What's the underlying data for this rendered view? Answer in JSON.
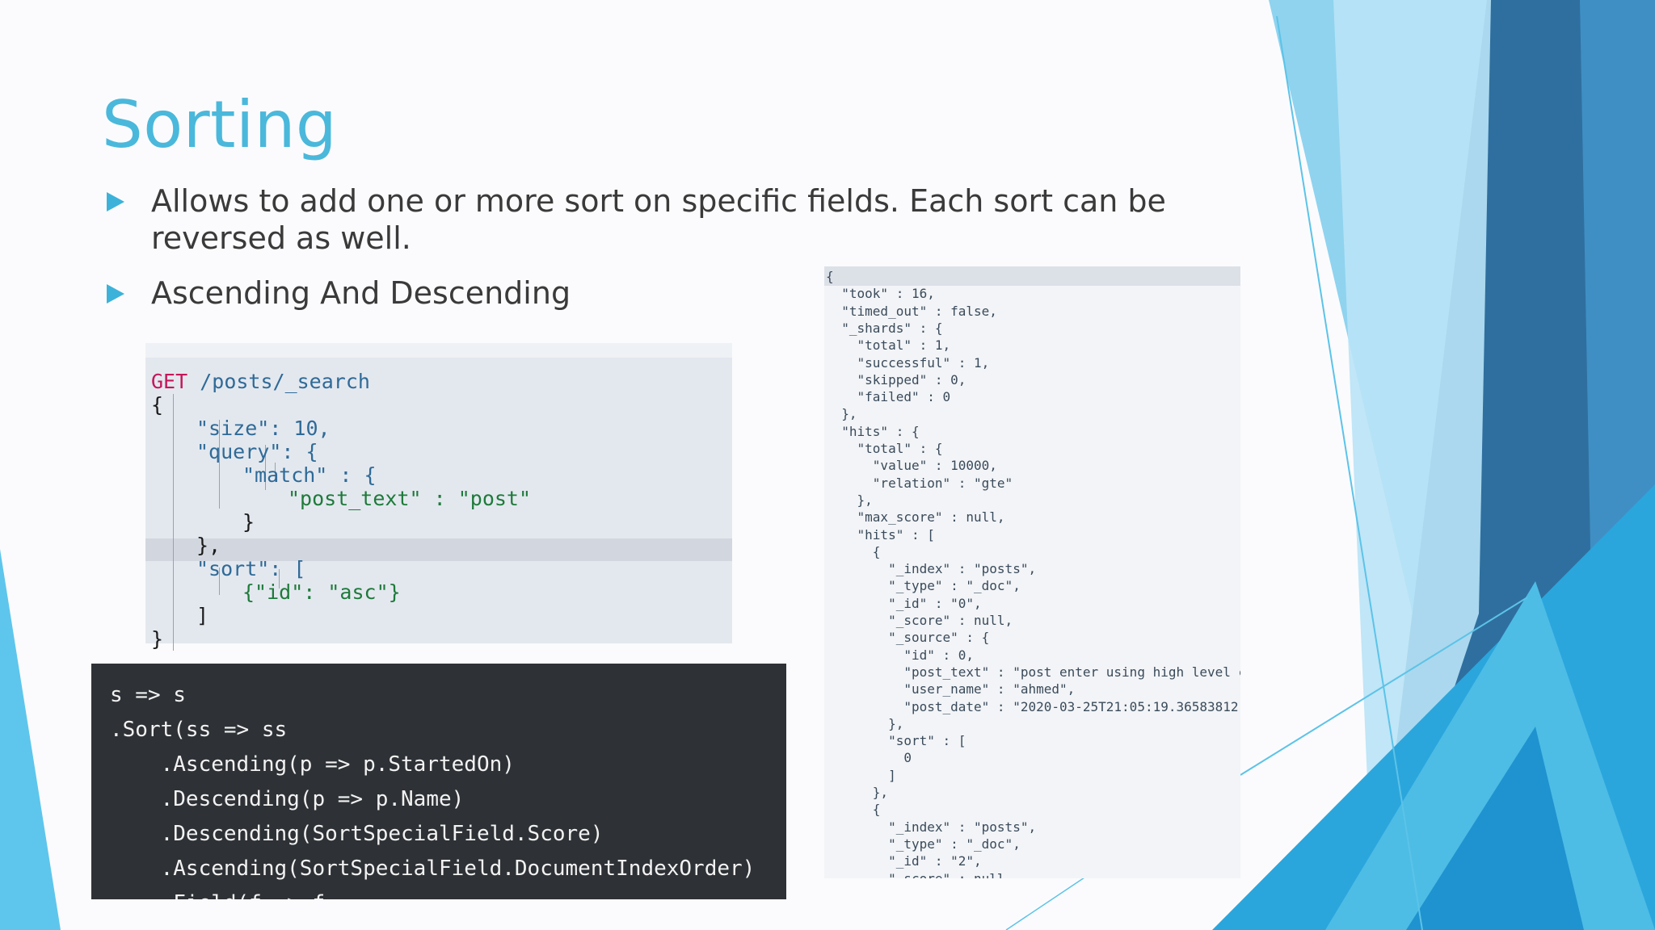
{
  "slide": {
    "title": "Sorting",
    "bullets": [
      {
        "text": "Allows to add one or more sort on specific fields. Each sort can be reversed as well."
      },
      {
        "text": "Ascending And Descending"
      }
    ]
  },
  "colors": {
    "title": "#4ab8db",
    "bullet_arrow": "#3cb2da",
    "deco_dark": "#2f6f9f",
    "deco_mid": "#2ba6dc",
    "deco_light": "#8fd3ef"
  },
  "console": {
    "method": "GET",
    "endpoint": "/posts/_search",
    "lines": [
      "{",
      "\"size\": 10,",
      "\"query\": {",
      "\"match\" : {",
      "\"post_text\" : \"post\"",
      "}",
      "},",
      "\"sort\": [",
      "{\"id\": \"asc\"}",
      "]",
      "}"
    ]
  },
  "nest_code": {
    "lines": [
      "s => s",
      ".Sort(ss => ss",
      "    .Ascending(p => p.StartedOn)",
      "    .Descending(p => p.Name)",
      "    .Descending(SortSpecialField.Score)",
      "    .Ascending(SortSpecialField.DocumentIndexOrder)",
      "    .Field(f => f"
    ]
  },
  "response": {
    "lines": [
      "{",
      "  \"took\" : 16,",
      "  \"timed_out\" : false,",
      "  \"_shards\" : {",
      "    \"total\" : 1,",
      "    \"successful\" : 1,",
      "    \"skipped\" : 0,",
      "    \"failed\" : 0",
      "  },",
      "  \"hits\" : {",
      "    \"total\" : {",
      "      \"value\" : 10000,",
      "      \"relation\" : \"gte\"",
      "    },",
      "    \"max_score\" : null,",
      "    \"hits\" : [",
      "      {",
      "        \"_index\" : \"posts\",",
      "        \"_type\" : \"_doc\",",
      "        \"_id\" : \"0\",",
      "        \"_score\" : null,",
      "        \"_source\" : {",
      "          \"id\" : 0,",
      "          \"post_text\" : \"post enter using high level client",
      "          \"user_name\" : \"ahmed\",",
      "          \"post_date\" : \"2020-03-25T21:05:19.36583812\"",
      "        },",
      "        \"sort\" : [",
      "          0",
      "        ]",
      "      },",
      "      {",
      "        \"_index\" : \"posts\",",
      "        \"_type\" : \"_doc\",",
      "        \"_id\" : \"2\",",
      "        \"_score\" : null"
    ]
  }
}
